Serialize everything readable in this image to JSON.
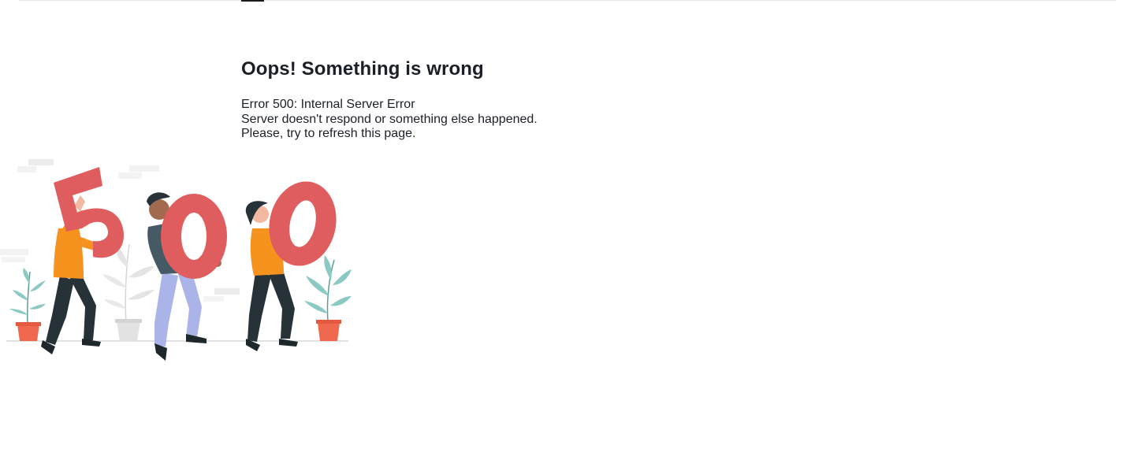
{
  "error": {
    "title": "Oops! Something is wrong",
    "lines": [
      "Error 500: Internal Server Error",
      "Server doesn't respond or something else happened.",
      "Please, try to refresh this page."
    ]
  },
  "illustration": {
    "digits": [
      "5",
      "0",
      "0"
    ]
  },
  "colors": {
    "digit_red": "#e05d5f",
    "shirt_orange": "#f6921e",
    "pants_dark": "#263238",
    "pants_lavender": "#aab4e8",
    "shirt_gray": "#455a64",
    "pot_orange": "#f0694e",
    "leaf_teal": "#8cc9c2"
  }
}
